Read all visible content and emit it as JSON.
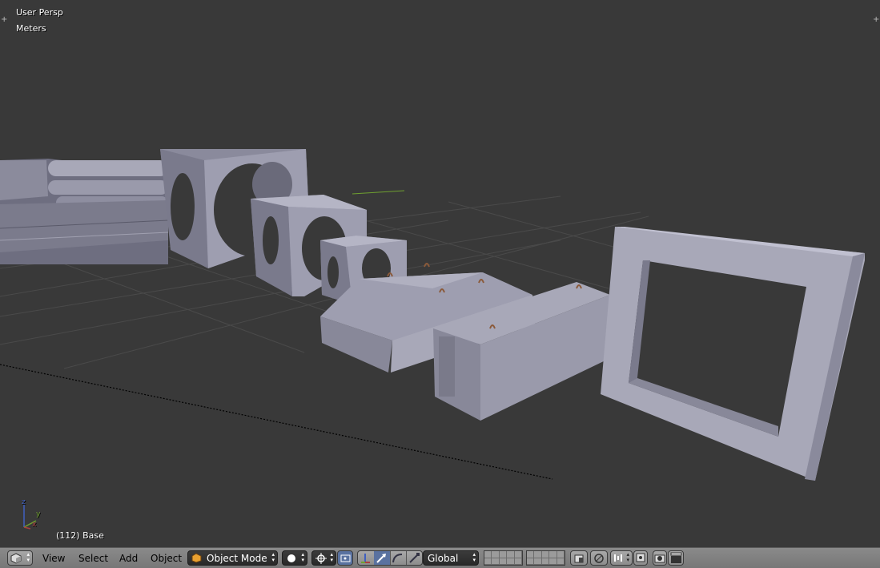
{
  "viewport": {
    "view_name": "User Persp",
    "units": "Meters",
    "object_info": "(112) Base",
    "axes": {
      "x": "x",
      "y": "y",
      "z": "z"
    }
  },
  "header": {
    "editor_type_icon": "3d-view-cube-icon",
    "menus": {
      "view": "View",
      "select": "Select",
      "add": "Add",
      "object": "Object"
    },
    "mode": {
      "icon": "object-mode-cube-icon",
      "label": "Object Mode"
    },
    "shading_icon": "solid-shading-sphere-icon",
    "pivot_icon": "pivot-point-icon",
    "manipulator_icon": "manipulator-icon",
    "orientation": "Global",
    "colors": {
      "x_axis": "#a84040",
      "y_axis": "#6fa030",
      "z_axis": "#4060c0",
      "object": "#9a9aab",
      "background": "#393939"
    }
  }
}
